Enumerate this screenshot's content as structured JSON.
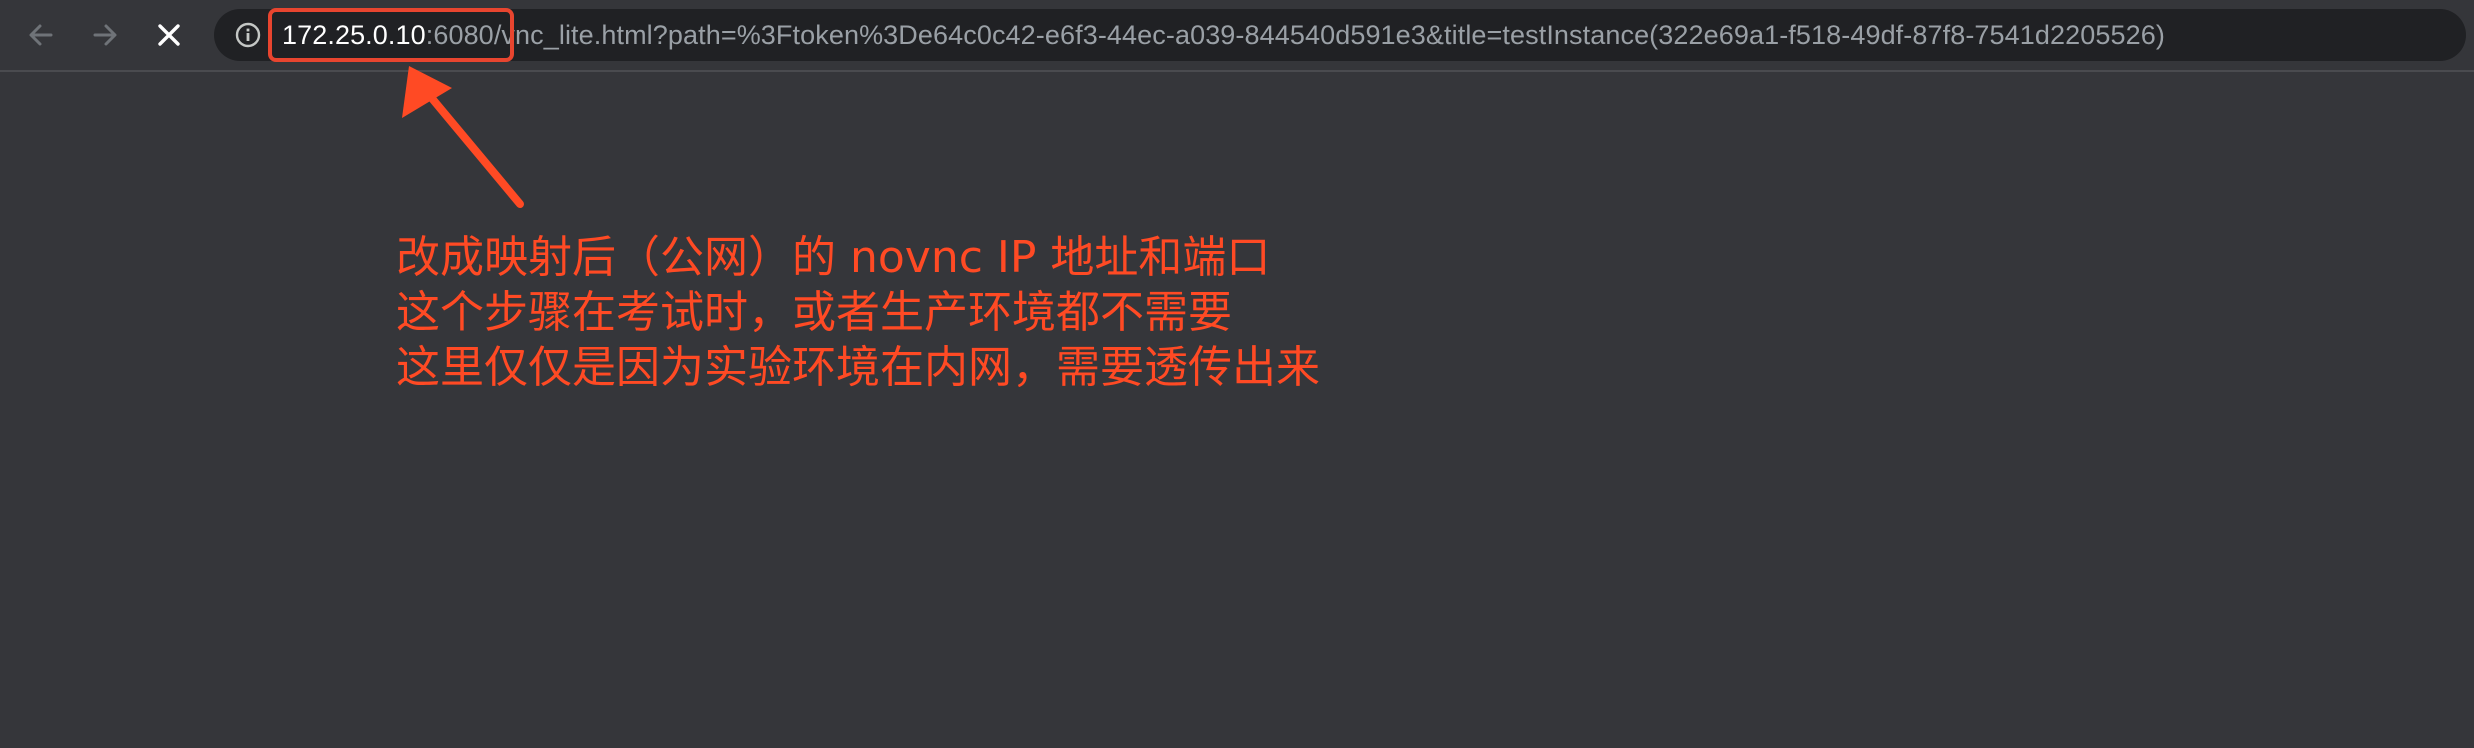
{
  "browser": {
    "url": {
      "host": "172.25.0.10",
      "port": ":6080",
      "path": "/vnc_lite.html?path=%3Ftoken%3De64c0c42-e6f3-44ec-a039-844540d591e3&title=testInstance(322e69a1-f518-49df-87f8-7541d2205526)"
    },
    "icons": {
      "back": "arrow-left-icon",
      "forward": "arrow-right-icon",
      "stop": "close-icon",
      "info": "info-icon"
    }
  },
  "annotation": {
    "color": "#ff4a24",
    "lines": [
      "改成映射后（公网）的 novnc IP 地址和端口",
      "这个步骤在考试时，或者生产环境都不需要",
      "这里仅仅是因为实验环境在内网，需要透传出来"
    ]
  },
  "colors": {
    "background": "#35363a",
    "omnibox": "#202124",
    "highlight": "#e8452f"
  }
}
